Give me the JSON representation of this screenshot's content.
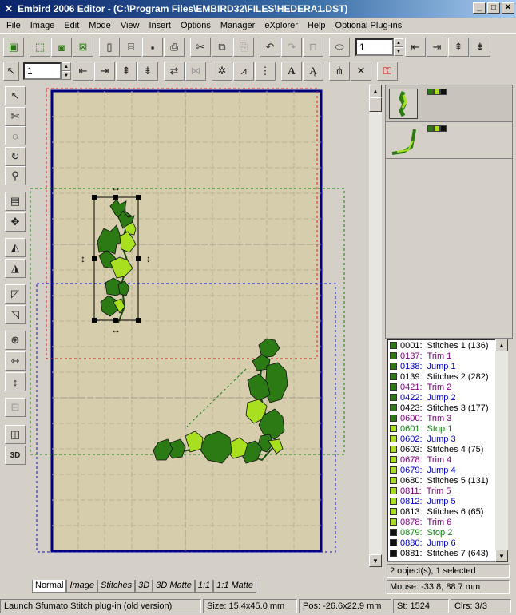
{
  "window": {
    "title": "Embird 2006 Editor - (C:\\Program Files\\EMBIRD32\\FILES\\HEDERA1.DST)",
    "min": "_",
    "max": "□",
    "close": "✕"
  },
  "menu": [
    "File",
    "Image",
    "Edit",
    "Mode",
    "View",
    "Insert",
    "Options",
    "Manager",
    "eXplorer",
    "Help",
    "Optional Plug-ins"
  ],
  "toolbar": {
    "spin1": "1",
    "spin2": "1"
  },
  "tabs": [
    "Normal",
    "Image",
    "Stitches",
    "3D",
    "3D Matte",
    "1:1",
    "1:1 Matte"
  ],
  "colors": {
    "dark": "#2b7a14",
    "light": "#a8e020",
    "black": "#111111",
    "trim": "#800080",
    "jump": "#0000c0",
    "stop": "#108010"
  },
  "color_list": [
    {
      "code": "0001:",
      "label": "Stitches 1 (136)",
      "kind": "stitch",
      "swatch": "#2b7a14"
    },
    {
      "code": "0137:",
      "label": "Trim 1",
      "kind": "trim",
      "swatch": "#2b7a14"
    },
    {
      "code": "0138:",
      "label": "Jump 1",
      "kind": "jump",
      "swatch": "#2b7a14"
    },
    {
      "code": "0139:",
      "label": "Stitches 2 (282)",
      "kind": "stitch",
      "swatch": "#2b7a14"
    },
    {
      "code": "0421:",
      "label": "Trim 2",
      "kind": "trim",
      "swatch": "#2b7a14"
    },
    {
      "code": "0422:",
      "label": "Jump 2",
      "kind": "jump",
      "swatch": "#2b7a14"
    },
    {
      "code": "0423:",
      "label": "Stitches 3 (177)",
      "kind": "stitch",
      "swatch": "#2b7a14"
    },
    {
      "code": "0600:",
      "label": "Trim 3",
      "kind": "trim",
      "swatch": "#2b7a14"
    },
    {
      "code": "0601:",
      "label": "Stop 1",
      "kind": "stop",
      "swatch": "#a8e020"
    },
    {
      "code": "0602:",
      "label": "Jump 3",
      "kind": "jump",
      "swatch": "#a8e020"
    },
    {
      "code": "0603:",
      "label": "Stitches 4 (75)",
      "kind": "stitch",
      "swatch": "#a8e020"
    },
    {
      "code": "0678:",
      "label": "Trim 4",
      "kind": "trim",
      "swatch": "#a8e020"
    },
    {
      "code": "0679:",
      "label": "Jump 4",
      "kind": "jump",
      "swatch": "#a8e020"
    },
    {
      "code": "0680:",
      "label": "Stitches 5 (131)",
      "kind": "stitch",
      "swatch": "#a8e020"
    },
    {
      "code": "0811:",
      "label": "Trim 5",
      "kind": "trim",
      "swatch": "#a8e020"
    },
    {
      "code": "0812:",
      "label": "Jump 5",
      "kind": "jump",
      "swatch": "#a8e020"
    },
    {
      "code": "0813:",
      "label": "Stitches 6 (65)",
      "kind": "stitch",
      "swatch": "#a8e020"
    },
    {
      "code": "0878:",
      "label": "Trim 6",
      "kind": "trim",
      "swatch": "#a8e020"
    },
    {
      "code": "0879:",
      "label": "Stop 2",
      "kind": "stop",
      "swatch": "#111111"
    },
    {
      "code": "0880:",
      "label": "Jump 6",
      "kind": "jump",
      "swatch": "#111111"
    },
    {
      "code": "0881:",
      "label": "Stitches 7 (643)",
      "kind": "stitch",
      "swatch": "#111111"
    }
  ],
  "selection_info": "2 object(s), 1 selected",
  "mouse_info": "Mouse: -33.8, 88.7 mm",
  "status": {
    "hint": "Launch Sfumato Stitch plug-in (old version)",
    "size": "Size: 15.4x45.0 mm",
    "pos": "Pos: -26.6x22.9 mm",
    "st": "St: 1524",
    "clrs": "Clrs: 3/3"
  },
  "resize_arrow_h": "↔",
  "resize_arrow_v": "↕"
}
